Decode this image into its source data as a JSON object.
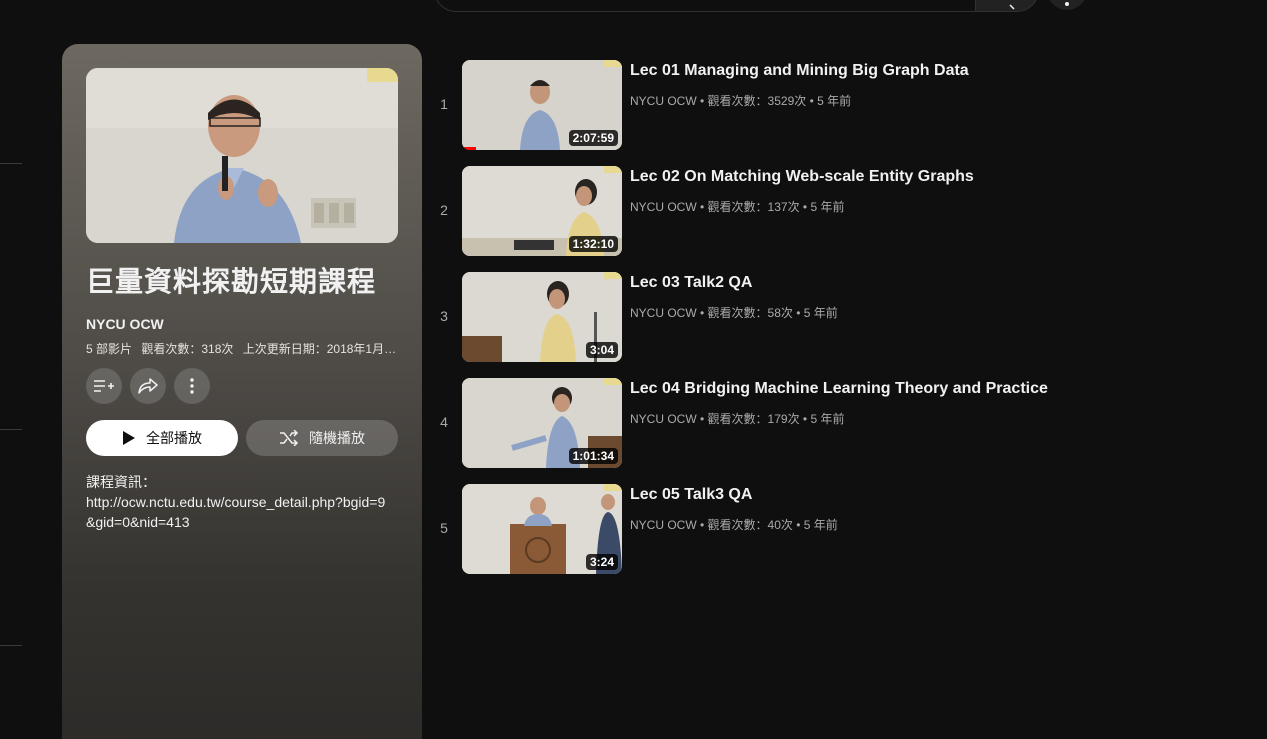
{
  "playlist": {
    "title": "巨量資料探勘短期課程",
    "owner": "NYCU OCW",
    "video_count": "5 部影片",
    "view_count": "觀看次數：318次",
    "last_updated": "上次更新日期：2018年1月1…",
    "play_all_label": "全部播放",
    "shuffle_label": "隨機播放",
    "description_label": "課程資訊：",
    "description_url": "http://ocw.nctu.edu.tw/course_detail.php?bgid=9&gid=0&nid=413"
  },
  "videos": [
    {
      "index": "1",
      "title": "Lec 01 Managing and Mining Big Graph Data",
      "channel": "NYCU OCW",
      "views": "觀看次數：3529次",
      "age": "5 年前",
      "duration": "2:07:59",
      "watched_fraction": 0.1
    },
    {
      "index": "2",
      "title": "Lec 02 On Matching Web-scale Entity Graphs",
      "channel": "NYCU OCW",
      "views": "觀看次數：137次",
      "age": "5 年前",
      "duration": "1:32:10"
    },
    {
      "index": "3",
      "title": "Lec 03 Talk2 QA",
      "channel": "NYCU OCW",
      "views": "觀看次數：58次",
      "age": "5 年前",
      "duration": "3:04"
    },
    {
      "index": "4",
      "title": "Lec 04 Bridging Machine Learning Theory and Practice",
      "channel": "NYCU OCW",
      "views": "觀看次數：179次",
      "age": "5 年前",
      "duration": "1:01:34"
    },
    {
      "index": "5",
      "title": "Lec 05 Talk3 QA",
      "channel": "NYCU OCW",
      "views": "觀看次數：40次",
      "age": "5 年前",
      "duration": "3:24"
    }
  ],
  "icons": {
    "add_to_queue": "playlist-add-icon",
    "share": "share-icon",
    "more": "more-vert-icon",
    "play": "play-icon",
    "shuffle": "shuffle-icon"
  },
  "colors": {
    "background": "#0f0f0f",
    "progress": "#ff0000",
    "secondary_text": "#aaaaaa"
  }
}
